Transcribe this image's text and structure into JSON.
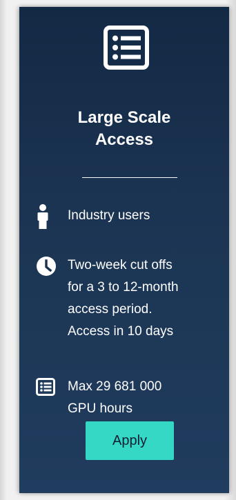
{
  "card": {
    "header_icon": "list-icon",
    "title_line1": "Large Scale",
    "title_line2": "Access",
    "features": [
      {
        "icon": "person-icon",
        "lines": [
          "Industry users"
        ]
      },
      {
        "icon": "clock-icon",
        "lines": [
          "Two-week cut offs",
          "for a 3 to 12-month",
          "access period.",
          "Access in 10 days"
        ]
      },
      {
        "icon": "list-icon",
        "lines": [
          "Max 29 681 000",
          "GPU hours"
        ]
      }
    ],
    "apply_label": "Apply"
  },
  "colors": {
    "card_top": "#132944",
    "card_bottom": "#203c5e",
    "accent": "#34d8c4",
    "text": "#ffffff"
  }
}
